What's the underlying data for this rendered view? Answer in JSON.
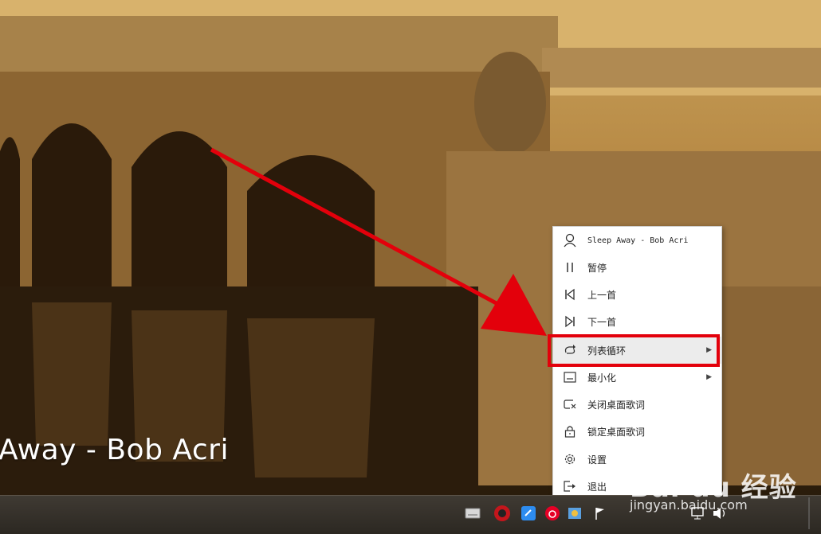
{
  "desktop": {
    "lyric_text": "Away - Bob Acri"
  },
  "menu": {
    "items": [
      {
        "label": "Sleep Away - Bob Acri",
        "icon": "person-icon"
      },
      {
        "label": "暂停",
        "icon": "pause-icon"
      },
      {
        "label": "上一首",
        "icon": "previous-track-icon"
      },
      {
        "label": "下一首",
        "icon": "next-track-icon"
      },
      {
        "label": "列表循环",
        "icon": "repeat-list-icon",
        "submenu": true
      },
      {
        "label": "最小化",
        "icon": "minimize-icon",
        "submenu": true
      },
      {
        "label": "关闭桌面歌词",
        "icon": "close-lyrics-icon"
      },
      {
        "label": "锁定桌面歌词",
        "icon": "lock-icon"
      },
      {
        "label": "设置",
        "icon": "gear-icon"
      },
      {
        "label": "退出",
        "icon": "exit-icon"
      }
    ],
    "submenu_arrow": "▶"
  },
  "colors": {
    "highlight_border": "#e3000b",
    "annotation_arrow": "#e3000b"
  },
  "watermark": {
    "brand": "Bai du 经验",
    "url": "jingyan.baidu.com"
  }
}
